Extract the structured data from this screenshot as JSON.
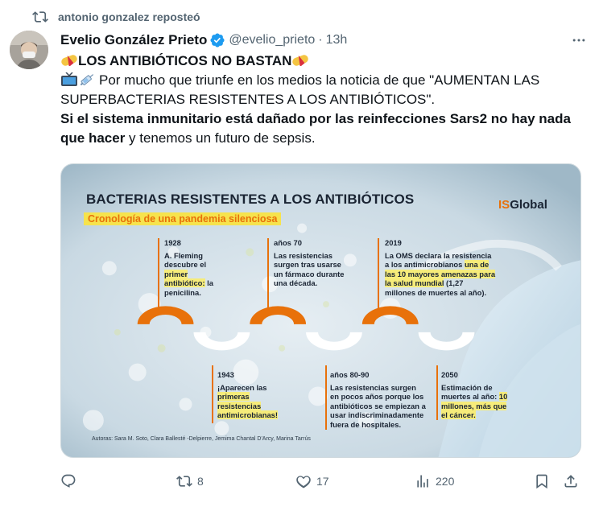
{
  "repost": {
    "label": "antonio gonzalez reposteó"
  },
  "tweet": {
    "author_name": "Evelio González Prieto",
    "handle": "@evelio_prieto",
    "separator": "·",
    "time": "13h",
    "headline": "LOS ANTIBIÓTICOS NO BASTAN",
    "paragraph": "Por mucho que triunfe en los medios la noticia de que \"AUMENTAN LAS SUPERBACTERIAS RESISTENTES A LOS ANTIBIÓTICOS\".",
    "bold_sentence": "Si el sistema inmunitario está dañado por las reinfecciones Sars2 no hay nada que hacer",
    "tail_sentence": " y tenemos un futuro de sepsis."
  },
  "infographic": {
    "title": "BACTERIAS RESISTENTES A LOS ANTIBIÓTICOS",
    "subtitle": "Cronología de una pandemia silenciosa",
    "brand_prefix": "IS",
    "brand_suffix": "Global",
    "events_top": [
      {
        "year": "1928",
        "pre": "A. Fleming descubre el ",
        "hl": "primer antibiótico:",
        "post": " la penicilina."
      },
      {
        "year": "años 70",
        "pre": "Las resistencias surgen tras usarse un fármaco durante una década.",
        "hl": "",
        "post": ""
      },
      {
        "year": "2019",
        "pre": "La OMS declara la resistencia a los antimicrobianos ",
        "hl": "una de las 10 mayores amenazas para la salud mundial",
        "post": " (1,27 millones de muertes al año)."
      }
    ],
    "events_bottom": [
      {
        "year": "1943",
        "pre": "¡Aparecen las ",
        "hl": "primeras resistencias antimicrobianas!",
        "post": ""
      },
      {
        "year": "años 80-90",
        "pre": "Las resistencias surgen en pocos años porque los antibióticos se empiezan a usar indiscriminadamente fuera de hospitales.",
        "hl": "",
        "post": ""
      },
      {
        "year": "2050",
        "pre": "Estimación de muertes al año: ",
        "hl": "10 millones, más que el cáncer.",
        "post": ""
      }
    ],
    "credits": "Autoras: Sara M. Soto, Clara Ballesté -Delpierre, Jemima Chantal D'Arcy, Marina Tarrús"
  },
  "actions": {
    "reply": {
      "icon": "reply-icon",
      "count": ""
    },
    "repost": {
      "icon": "repost-icon",
      "count": "8"
    },
    "like": {
      "icon": "heart-icon",
      "count": "17"
    },
    "views": {
      "icon": "views-icon",
      "count": "220"
    },
    "bookmark": {
      "icon": "bookmark-icon",
      "count": ""
    },
    "share": {
      "icon": "share-icon",
      "count": ""
    }
  },
  "colors": {
    "accent": "#1d9bf0",
    "muted": "#536471",
    "orange": "#e8710a",
    "highlight": "#f6e34d"
  }
}
